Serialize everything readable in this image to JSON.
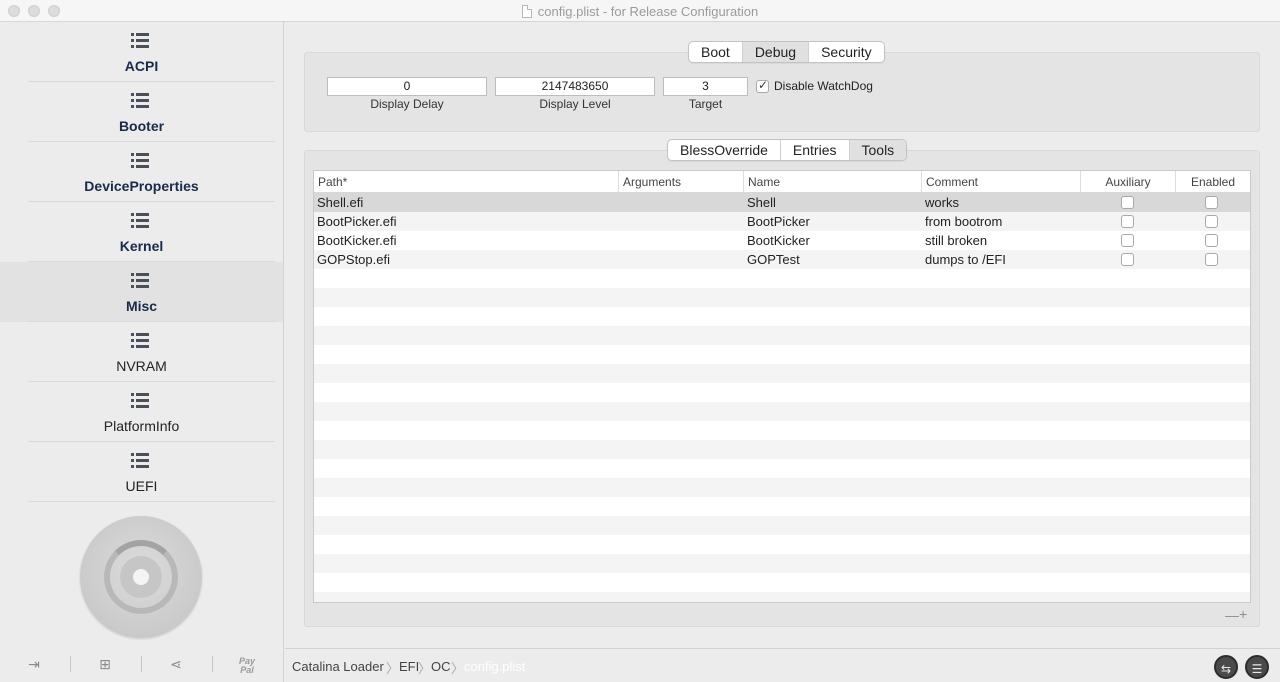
{
  "window": {
    "title": "config.plist - for Release Configuration"
  },
  "sidebar": {
    "items": [
      {
        "label": "ACPI"
      },
      {
        "label": "Booter"
      },
      {
        "label": "DeviceProperties"
      },
      {
        "label": "Kernel"
      },
      {
        "label": "Misc"
      },
      {
        "label": "NVRAM"
      },
      {
        "label": "PlatformInfo"
      },
      {
        "label": "UEFI"
      }
    ],
    "selected": "Misc",
    "bottom": {
      "paypal_line1": "Pay",
      "paypal_line2": "Pal"
    }
  },
  "misc": {
    "top_tabs": [
      {
        "label": "Boot"
      },
      {
        "label": "Debug"
      },
      {
        "label": "Security"
      }
    ],
    "selected_top_tab": "Debug",
    "debug": {
      "display_delay_value": "0",
      "display_delay_label": "Display Delay",
      "display_level_value": "2147483650",
      "display_level_label": "Display Level",
      "target_value": "3",
      "target_label": "Target",
      "disable_watchdog_label": "Disable WatchDog",
      "disable_watchdog_checked": true
    },
    "lower_tabs": [
      {
        "label": "BlessOverride"
      },
      {
        "label": "Entries"
      },
      {
        "label": "Tools"
      }
    ],
    "selected_lower_tab": "Tools",
    "table": {
      "columns": [
        "Path*",
        "Arguments",
        "Name",
        "Comment",
        "Auxiliary",
        "Enabled"
      ],
      "rows": [
        {
          "path": "Shell.efi",
          "arguments": "",
          "name": "Shell",
          "comment": "works",
          "auxiliary": false,
          "enabled": false
        },
        {
          "path": "BootPicker.efi",
          "arguments": "",
          "name": "BootPicker",
          "comment": "from bootrom",
          "auxiliary": false,
          "enabled": false
        },
        {
          "path": "BootKicker.efi",
          "arguments": "",
          "name": "BootKicker",
          "comment": "still broken",
          "auxiliary": false,
          "enabled": false
        },
        {
          "path": "GOPStop.efi",
          "arguments": "",
          "name": "GOPTest",
          "comment": "dumps to /EFI",
          "auxiliary": false,
          "enabled": false
        }
      ]
    },
    "remove_label": "—",
    "add_label": "+"
  },
  "pathbar": {
    "crumbs": [
      "Catalina Loader",
      "EFI",
      "OC",
      "config.plist"
    ],
    "separator": "〉"
  },
  "icons": {
    "left_button": "swap-arrows-icon",
    "right_button": "list-icon"
  }
}
